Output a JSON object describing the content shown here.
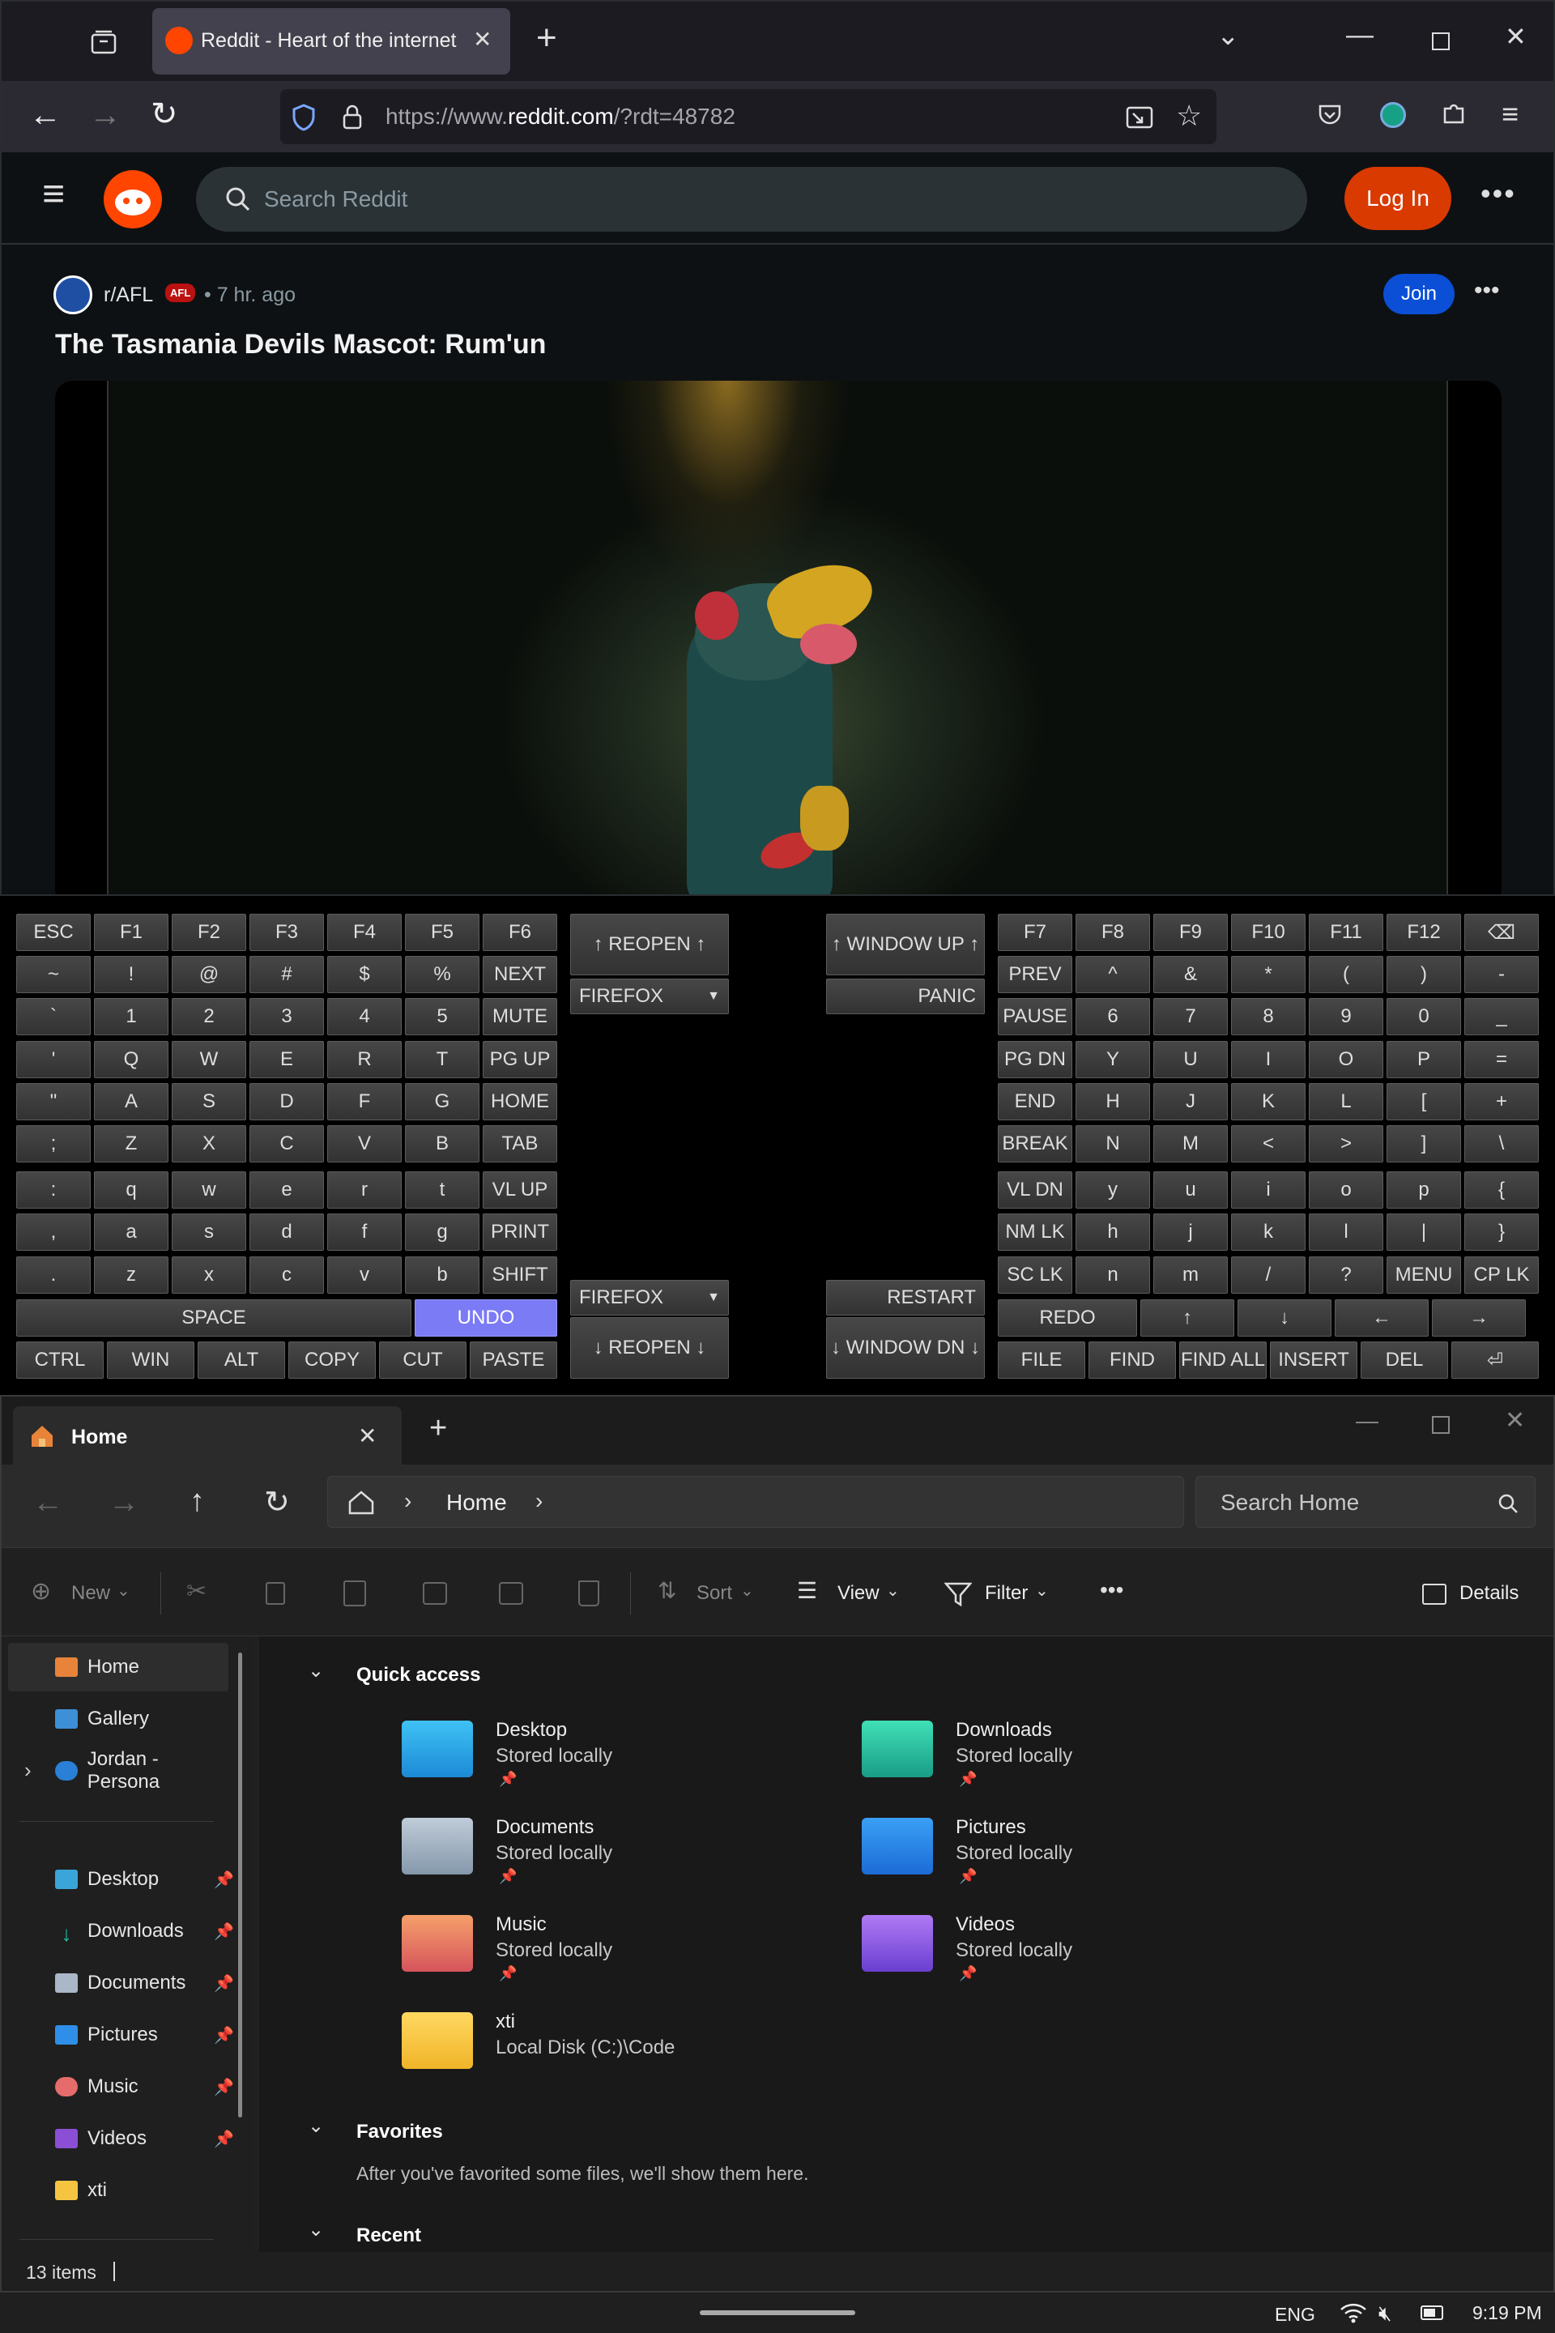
{
  "browser": {
    "tab_title": "Reddit - Heart of the internet",
    "url_prefix": "https://www.",
    "url_domain": "reddit.com",
    "url_suffix": "/?rdt=48782",
    "new_tab": "+",
    "close_tab": "✕"
  },
  "reddit": {
    "search_placeholder": "Search Reddit",
    "login": "Log In",
    "post": {
      "subreddit": "r/AFL",
      "flair": "AFL",
      "age": "• 7 hr. ago",
      "join": "Join",
      "title": "The Tasmania Devils Mascot: Rum'un"
    }
  },
  "keyboard": {
    "left_rows": [
      [
        "ESC",
        "F1",
        "F2",
        "F3",
        "F4",
        "F5",
        "F6"
      ],
      [
        "~",
        "!",
        "@",
        "#",
        "$",
        "%",
        "NEXT"
      ],
      [
        "`",
        "1",
        "2",
        "3",
        "4",
        "5",
        "MUTE"
      ],
      [
        "'",
        "Q",
        "W",
        "E",
        "R",
        "T",
        "PG UP"
      ],
      [
        "\"",
        "A",
        "S",
        "D",
        "F",
        "G",
        "HOME"
      ],
      [
        ";",
        "Z",
        "X",
        "C",
        "V",
        "B",
        "TAB"
      ],
      [
        ":",
        "q",
        "w",
        "e",
        "r",
        "t",
        "VL UP"
      ],
      [
        ",",
        "a",
        "s",
        "d",
        "f",
        "g",
        "PRINT"
      ],
      [
        ".",
        "z",
        "x",
        "c",
        "v",
        "b",
        "SHIFT"
      ]
    ],
    "right_rows": [
      [
        "F7",
        "F8",
        "F9",
        "F10",
        "F11",
        "F12",
        "⌫"
      ],
      [
        "PREV",
        "^",
        "&",
        "*",
        "(",
        ")",
        "-"
      ],
      [
        "PAUSE",
        "6",
        "7",
        "8",
        "9",
        "0",
        "_"
      ],
      [
        "PG DN",
        "Y",
        "U",
        "I",
        "O",
        "P",
        "="
      ],
      [
        "END",
        "H",
        "J",
        "K",
        "L",
        "[",
        "+"
      ],
      [
        "BREAK",
        "N",
        "M",
        "<",
        ">",
        "]",
        "\\"
      ],
      [
        "VL DN",
        "y",
        "u",
        "i",
        "o",
        "p",
        "{"
      ],
      [
        "NM LK",
        "h",
        "j",
        "k",
        "l",
        "|",
        "}"
      ],
      [
        "SC LK",
        "n",
        "m",
        "/",
        "?",
        "MENU",
        "CP LK"
      ]
    ],
    "space": "SPACE",
    "undo": "UNDO",
    "left_bottom": [
      "CTRL",
      "WIN",
      "ALT",
      "COPY",
      "CUT",
      "PASTE"
    ],
    "redo": "REDO",
    "right_arrows": [
      "↑",
      "↓",
      "←",
      "→"
    ],
    "right_bottom": [
      "FILE",
      "FIND",
      "FIND ALL",
      "INSERT",
      "DEL",
      "⏎"
    ],
    "reopen_up": "↑ REOPEN ↑",
    "reopen_down": "↓ REOPEN ↓",
    "window_up": "↑ WINDOW UP ↑",
    "window_down": "↓ WINDOW DN ↓",
    "app_top": "FIREFOX",
    "app_bottom": "FIREFOX",
    "panic": "PANIC",
    "restart": "RESTART"
  },
  "explorer": {
    "tab": "Home",
    "breadcrumb": "Home",
    "search_placeholder": "Search Home",
    "toolbar": {
      "new": "New",
      "sort": "Sort",
      "view": "View",
      "filter": "Filter",
      "more": "•••",
      "details": "Details"
    },
    "sidebar_top": [
      {
        "label": "Home"
      },
      {
        "label": "Gallery"
      },
      {
        "label": "Jordan - Persona"
      }
    ],
    "sidebar_pinned": [
      {
        "label": "Desktop"
      },
      {
        "label": "Downloads"
      },
      {
        "label": "Documents"
      },
      {
        "label": "Pictures"
      },
      {
        "label": "Music"
      },
      {
        "label": "Videos"
      },
      {
        "label": "xti"
      }
    ],
    "sections": {
      "quick_access": "Quick access",
      "favorites": "Favorites",
      "favorites_empty": "After you've favorited some files, we'll show them here.",
      "recent": "Recent"
    },
    "quick_access": [
      {
        "name": "Desktop",
        "sub": "Stored locally"
      },
      {
        "name": "Downloads",
        "sub": "Stored locally"
      },
      {
        "name": "Documents",
        "sub": "Stored locally"
      },
      {
        "name": "Pictures",
        "sub": "Stored locally"
      },
      {
        "name": "Music",
        "sub": "Stored locally"
      },
      {
        "name": "Videos",
        "sub": "Stored locally"
      },
      {
        "name": "xti",
        "sub": "Local Disk (C:)\\Code"
      }
    ],
    "status": "13 items"
  },
  "taskbar": {
    "lang": "ENG",
    "time": "9:19 PM"
  },
  "colors": {
    "reddit_orange": "#d93a00",
    "join_blue": "#0a4fd6",
    "undo_highlight": "#7b7bf5"
  }
}
